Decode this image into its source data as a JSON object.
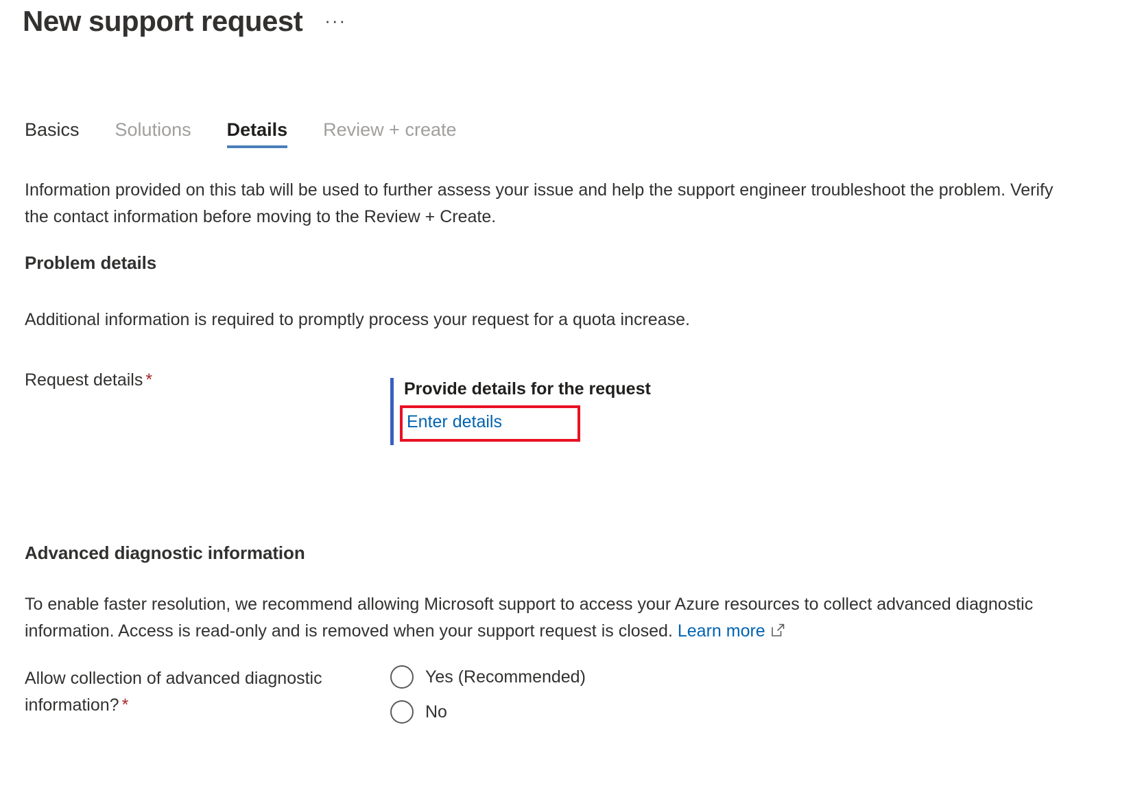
{
  "header": {
    "title": "New support request",
    "more_menu": "···"
  },
  "tabs": [
    {
      "label": "Basics",
      "state": "enabled"
    },
    {
      "label": "Solutions",
      "state": "disabled"
    },
    {
      "label": "Details",
      "state": "active"
    },
    {
      "label": "Review + create",
      "state": "disabled"
    }
  ],
  "intro": "Information provided on this tab will be used to further assess your issue and help the support engineer troubleshoot the problem. Verify the contact information before moving to the Review + Create.",
  "problem_details": {
    "heading": "Problem details",
    "paragraph": "Additional information is required to promptly process your request for a quota increase.",
    "request_details": {
      "label": "Request details",
      "required_marker": "*",
      "control_title": "Provide details for the request",
      "link_label": "Enter details",
      "highlight_color": "#e81123",
      "accent_color": "#3b5fc0"
    }
  },
  "advanced_diagnostic": {
    "heading": "Advanced diagnostic information",
    "paragraph_before_link": "To enable faster resolution, we recommend allowing Microsoft support to access your Azure resources to collect advanced diagnostic information. Access is read-only and is removed when your support request is closed. ",
    "learn_more_label": "Learn more",
    "learn_more_icon": "external-link-icon",
    "question": {
      "label": "Allow collection of advanced diagnostic information?",
      "required_marker": "*"
    },
    "options": [
      {
        "label": "Yes (Recommended)",
        "selected": false
      },
      {
        "label": "No",
        "selected": false
      }
    ]
  },
  "colors": {
    "link": "#0063b1",
    "accent_tab": "#4a7ebb",
    "required": "#a4262c",
    "text": "#323130"
  }
}
